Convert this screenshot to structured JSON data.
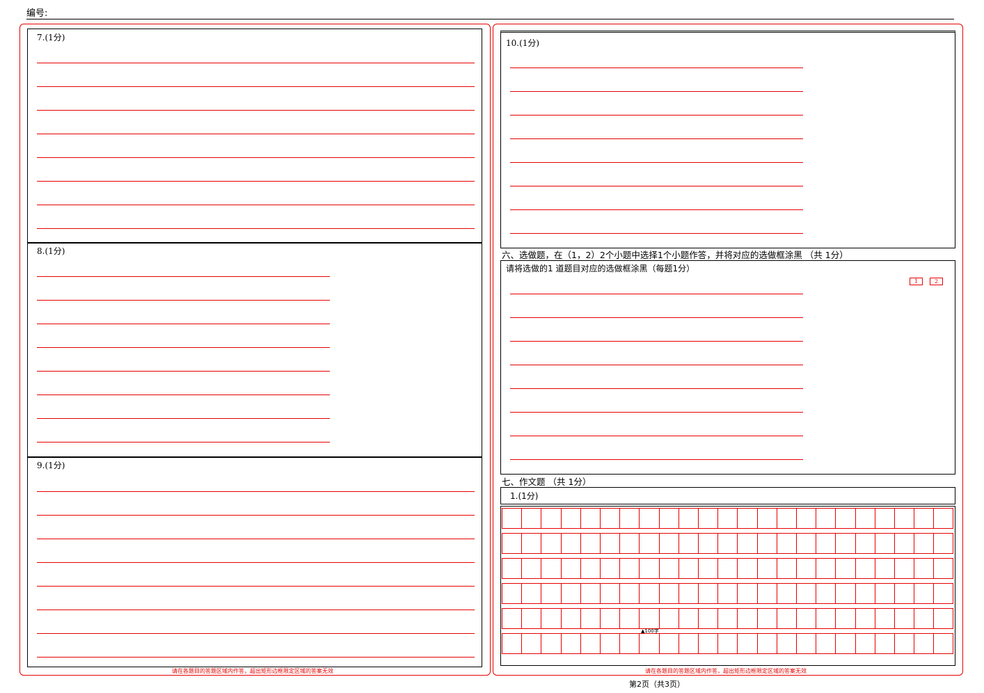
{
  "header": {
    "label": "编号:"
  },
  "left": {
    "questions": [
      {
        "label": "7.(1分)",
        "lines": 8
      },
      {
        "label": "8.(1分)",
        "lines": 8
      },
      {
        "label": "9.(1分)",
        "lines": 8
      }
    ],
    "warning": "请在各题目的答题区域内作答，超出矩形边框限定区域的答案无效"
  },
  "right": {
    "q10": {
      "label": "10.(1分)",
      "lines": 8
    },
    "section6": {
      "title": "六、选做题，在（1，2）2个小题中选择1个小题作答，并将对应的选做框涂黑  （共 1分）",
      "instruction": "请将选做的1 道题目对应的选做框涂黑（每题1分）",
      "choices": [
        "1",
        "2"
      ],
      "lines": 8
    },
    "section7": {
      "title": "七、作文题  （共 1分）",
      "question_label": "1.(1分)",
      "grid_rows": 6,
      "grid_cols": 23,
      "word_mark": "▲100字"
    },
    "warning": "请在各题目的答题区域内作答，超出矩形边框限定区域的答案无效"
  },
  "footer": {
    "page": "第2页（共3页）"
  },
  "colors": {
    "accent": "#e60000",
    "frame": "#000000"
  }
}
